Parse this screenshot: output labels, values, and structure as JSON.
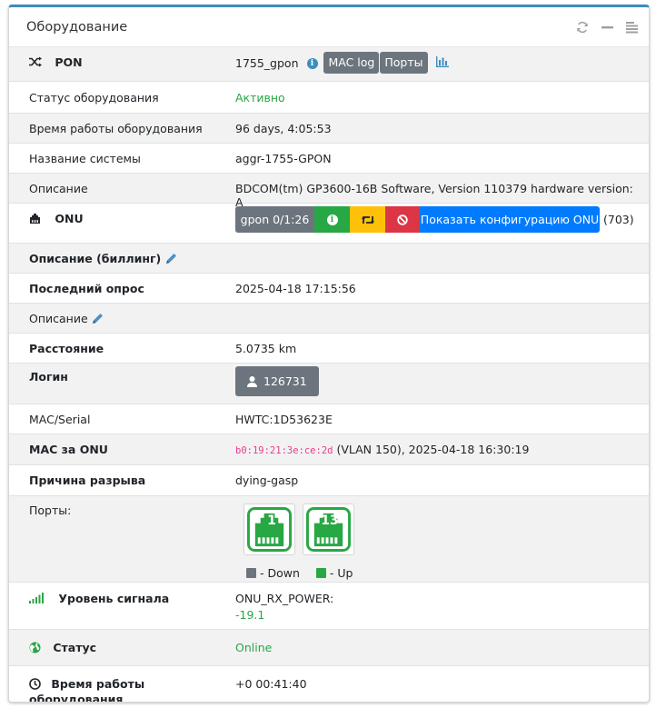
{
  "header": {
    "title": "Оборудование"
  },
  "pon": {
    "label": "PON",
    "device": "1755_gpon",
    "mac_log_button": "MAC log",
    "ports_button": "Порты"
  },
  "rows": {
    "status_label": "Статус оборудования",
    "status_value": "Активно",
    "uptime_label": "Время работы оборудования",
    "uptime_value": "96 days, 4:05:53",
    "sysname_label": "Название системы",
    "sysname_value": "aggr-1755-GPON",
    "descr_label": "Описание",
    "descr_value": "BDCOM(tm) GP3600-16B Software, Version 110379 hardware version: A"
  },
  "onu": {
    "label": "ONU",
    "iface_button": "gpon 0/1:26",
    "show_config_button": "Показать конфигурацию ONU",
    "count": "(703)",
    "billing_descr_label": "Описание (биллинг)",
    "last_poll_label": "Последний опрос",
    "last_poll_value": "2025-04-18 17:15:56",
    "descr_label": "Описание",
    "distance_label": "Расстояние",
    "distance_value": "5.0735 km",
    "login_label": "Логин",
    "login_value": "126731",
    "mac_serial_label": "MAC/Serial",
    "mac_serial_value": "HWTC:1D53623E",
    "mac_behind_label": "MAC за ONU",
    "mac_behind_mac": "b0:19:21:3e:ce:2d",
    "mac_behind_rest": " (VLAN 150), 2025-04-18 16:30:19",
    "reason_label": "Причина разрыва",
    "reason_value": "dying-gasp",
    "ports_label": "Порты:",
    "port1": "1",
    "port2": "13",
    "legend_down": "- Down",
    "legend_up": "- Up",
    "signal_label": "Уровень сигнала",
    "signal_key": "ONU_RX_POWER:",
    "signal_value": "-19.1",
    "status_label": "Статус",
    "status_value": "Online",
    "uptime_label": "Время работы оборудования",
    "uptime_value": "+0 00:41:40"
  },
  "colors": {
    "accent": "#3c8dbc",
    "green": "#28a745",
    "yellow": "#ffc107",
    "red": "#dc3545",
    "blue": "#007bff",
    "gray": "#6c757d"
  }
}
